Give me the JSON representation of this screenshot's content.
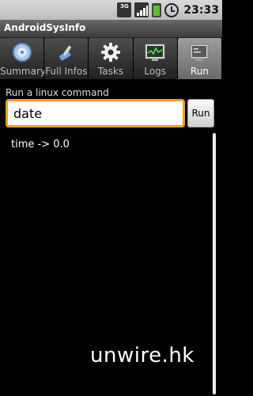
{
  "status_bar": {
    "network_type": "3G",
    "time": "23:33"
  },
  "app": {
    "title": "AndroidSysInfo"
  },
  "tabs": [
    {
      "label": "Summary",
      "icon": "summary-icon",
      "active": false
    },
    {
      "label": "Full Infos",
      "icon": "wrench-icon",
      "active": false
    },
    {
      "label": "Tasks",
      "icon": "gear-icon",
      "active": false
    },
    {
      "label": "Logs",
      "icon": "log-chart-icon",
      "active": false
    },
    {
      "label": "Run",
      "icon": "terminal-icon",
      "active": true
    }
  ],
  "command": {
    "label": "Run a linux command",
    "value": "date",
    "run_label": "Run"
  },
  "output": {
    "text": "time -> 0.0"
  },
  "watermark": "unwire.hk",
  "colors": {
    "input_focus": "#f59f1a",
    "active_tab": "#8a8a8a"
  }
}
